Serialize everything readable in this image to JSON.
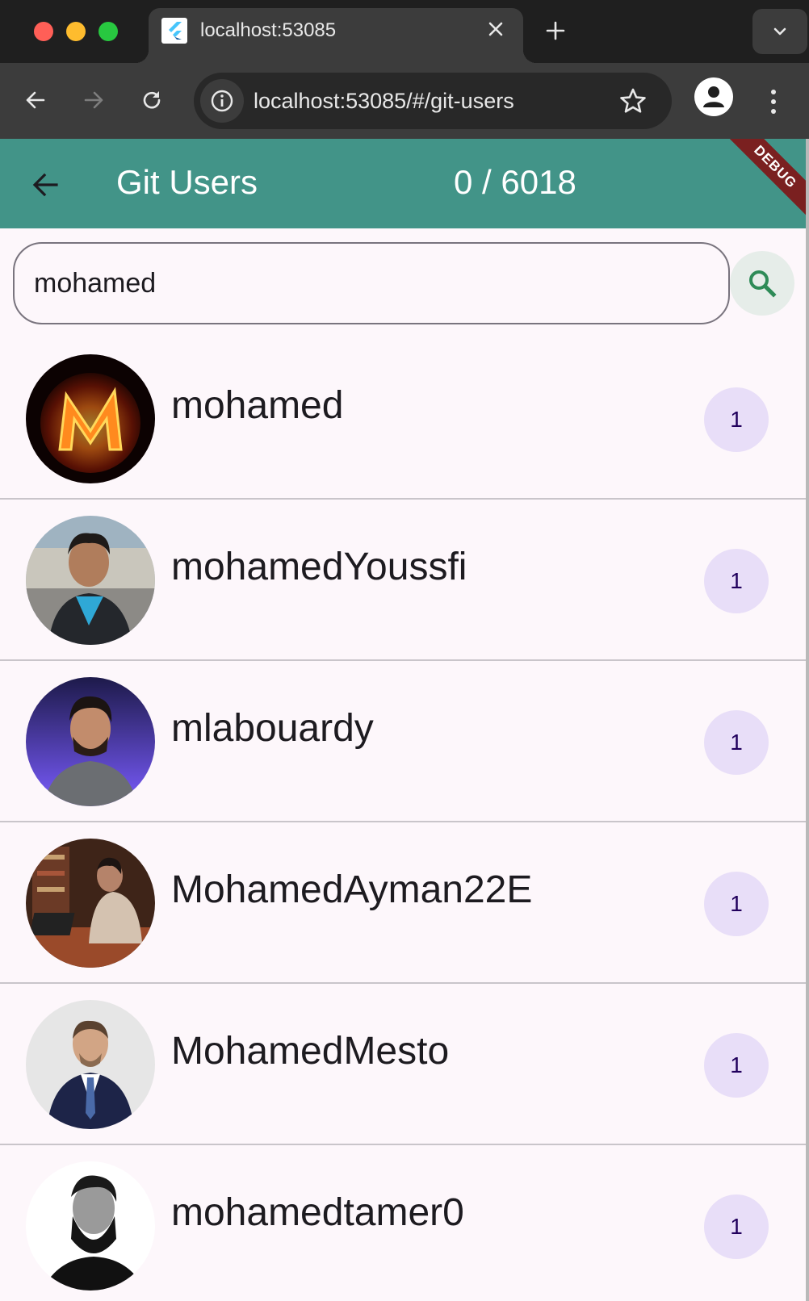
{
  "browser": {
    "tab_title": "localhost:53085",
    "url": "localhost:53085/#/git-users"
  },
  "app": {
    "title": "Git Users",
    "count": "0 / 6018",
    "debug_banner": "DEBUG",
    "accent_color": "#429488"
  },
  "search": {
    "value": "mohamed"
  },
  "users": [
    {
      "login": "mohamed",
      "badge": "1"
    },
    {
      "login": "mohamedYoussfi",
      "badge": "1"
    },
    {
      "login": "mlabouardy",
      "badge": "1"
    },
    {
      "login": "MohamedAyman22E",
      "badge": "1"
    },
    {
      "login": "MohamedMesto",
      "badge": "1"
    },
    {
      "login": "mohamedtamer0",
      "badge": "1"
    }
  ]
}
